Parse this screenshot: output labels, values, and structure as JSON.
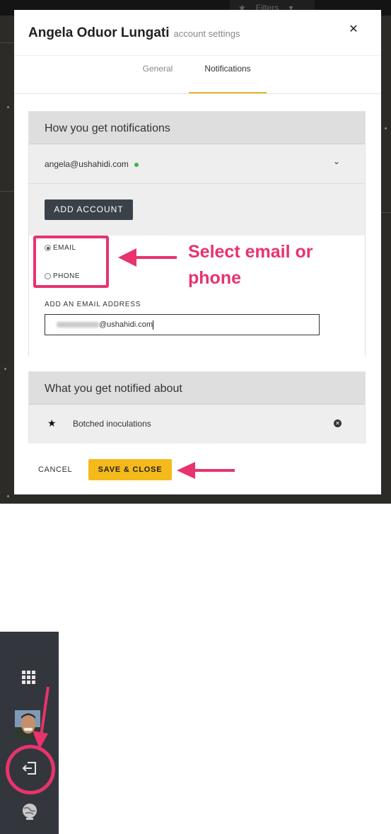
{
  "topbar": {
    "filters_label": "Filters"
  },
  "modal": {
    "title": "Angela Oduor Lungati",
    "subtitle": "account settings",
    "tabs": [
      {
        "label": "General",
        "active": false
      },
      {
        "label": "Notifications",
        "active": true
      }
    ]
  },
  "how_section": {
    "heading": "How you get notifications",
    "account_email": "angela@ushahidi.com",
    "account_status_color": "#3cb44a",
    "add_account_label": "ADD ACCOUNT",
    "radio_options": [
      {
        "label": "EMAIL",
        "selected": true
      },
      {
        "label": "PHONE",
        "selected": false
      }
    ],
    "add_email_label": "ADD AN EMAIL ADDRESS",
    "email_value": "@ushahidi.com"
  },
  "annotation": {
    "line1": "Select email or",
    "line2": "phone",
    "color": "#e8336d"
  },
  "what_section": {
    "heading": "What you get notified about",
    "topics": [
      {
        "label": "Botched inoculations",
        "icon": "star-icon"
      }
    ]
  },
  "footer": {
    "cancel_label": "CANCEL",
    "save_label": "SAVE & CLOSE",
    "save_color": "#f4b91a"
  },
  "sidebar": {
    "items": [
      {
        "icon": "grid-icon"
      },
      {
        "icon": "avatar"
      },
      {
        "icon": "logout-icon"
      },
      {
        "icon": "globe-icon"
      }
    ]
  }
}
